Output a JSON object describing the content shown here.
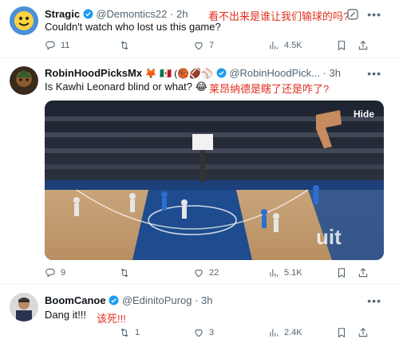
{
  "tweets": [
    {
      "name": "Stragic",
      "handle": "@Demontics22",
      "time": "2h",
      "text": "Couldn't watch who lost us this game?",
      "translation": "看不出来是谁让我们输球的吗?",
      "stats": {
        "replies": "11",
        "retweets": "",
        "likes": "7",
        "views": "4.5K"
      }
    },
    {
      "name": "RobinHoodPicksMx",
      "name_emojis": "🦊 🇲🇽 (🏀🏈⚾",
      "handle": "@RobinHoodPick...",
      "time": "3h",
      "text": "Is Kawhi Leonard blind or what? 😂",
      "translation": "莱昂纳德是瞎了还是咋了?",
      "media_hide_label": "Hide",
      "stats": {
        "replies": "9",
        "retweets": "",
        "likes": "22",
        "views": "5.1K"
      }
    },
    {
      "name": "BoomCanoe",
      "handle": "@EdinitoPurog",
      "time": "3h",
      "text": "Dang it!!!",
      "translation": "该死!!!",
      "stats": {
        "replies": "",
        "retweets": "1",
        "likes": "3",
        "views": "2.4K"
      }
    }
  ],
  "icons": {
    "reply": "reply-icon",
    "retweet": "retweet-icon",
    "like": "heart-icon",
    "views": "views-icon",
    "bookmark": "bookmark-icon",
    "share": "share-icon",
    "grok": "grok-icon",
    "more": "more-icon",
    "verified": "verified-badge-icon"
  },
  "colors": {
    "accent": "#1d9bf0",
    "text": "#0f1419",
    "muted": "#536471",
    "annotation": "#e0301e"
  }
}
